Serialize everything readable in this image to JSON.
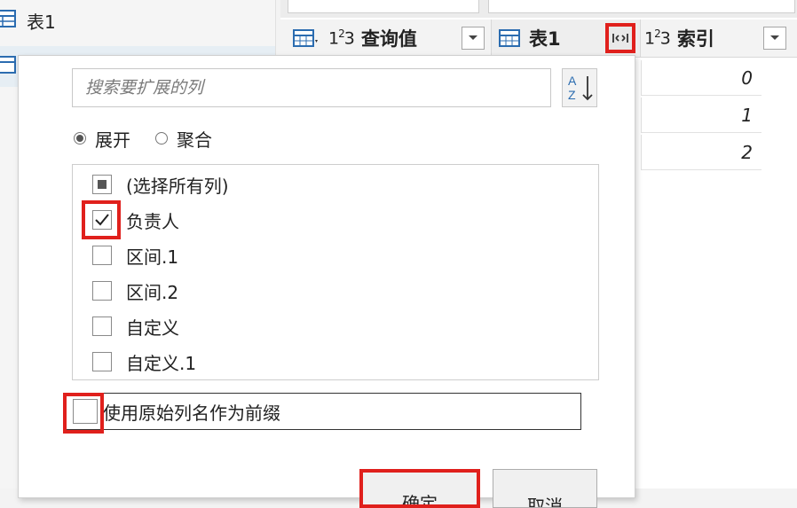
{
  "queries": {
    "items": [
      {
        "label": "表1",
        "icon": "table-icon"
      },
      {
        "label": "",
        "icon": "table-icon"
      }
    ]
  },
  "grid": {
    "columns": [
      {
        "type": "123",
        "title": "查询值",
        "icon": "table-menu-icon"
      },
      {
        "type": "table",
        "title": "表1",
        "expand_icon": "expand-columns-icon"
      },
      {
        "type": "123",
        "title": "索引"
      }
    ],
    "index_values": [
      "0",
      "1",
      "2"
    ]
  },
  "expand_popup": {
    "search_placeholder": "搜索要扩展的列",
    "sort_icon": "sort-az-icon",
    "modes": [
      {
        "label": "展开",
        "selected": true
      },
      {
        "label": "聚合",
        "selected": false
      }
    ],
    "select_all": {
      "label": "(选择所有列)",
      "state": "indeterminate"
    },
    "columns": [
      {
        "label": "负责人",
        "checked": true
      },
      {
        "label": "区间.1",
        "checked": false
      },
      {
        "label": "区间.2",
        "checked": false
      },
      {
        "label": "自定义",
        "checked": false
      },
      {
        "label": "自定义.1",
        "checked": false
      }
    ],
    "prefix_option": {
      "label": "使用原始列名作为前缀",
      "checked": false
    },
    "ok_label": "确定",
    "cancel_label": "取消"
  },
  "colors": {
    "highlight": "#e0201c",
    "accent_blue": "#2b6cb0"
  }
}
